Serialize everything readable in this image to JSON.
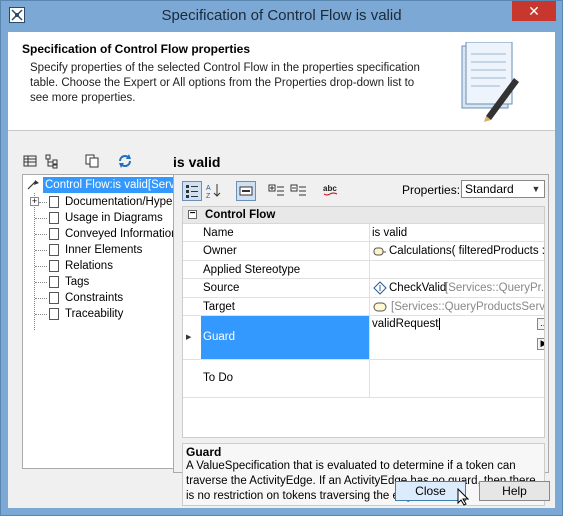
{
  "window": {
    "title": "Specification of Control Flow is valid",
    "close_glyph": "✕"
  },
  "header": {
    "title": "Specification of Control Flow properties",
    "description": "Specify properties of the selected Control Flow in the properties specification table. Choose the Expert or All options from the Properties drop-down list to see more properties."
  },
  "page_heading": "is valid",
  "left_toolbar": {
    "icons": [
      "list-view-icon",
      "tree-view-icon",
      "copy-icon",
      "refresh-icon"
    ]
  },
  "tree": {
    "root": "Control Flow:is valid[Servic",
    "items": [
      {
        "label": "Documentation/Hyperli",
        "expandable": true
      },
      {
        "label": "Usage in Diagrams",
        "expandable": false
      },
      {
        "label": "Conveyed Information",
        "expandable": false
      },
      {
        "label": "Inner Elements",
        "expandable": false
      },
      {
        "label": "Relations",
        "expandable": false
      },
      {
        "label": "Tags",
        "expandable": false
      },
      {
        "label": "Constraints",
        "expandable": false
      },
      {
        "label": "Traceability",
        "expandable": false
      }
    ]
  },
  "properties": {
    "label": "Properties:",
    "selected": "Standard",
    "toolbar_icons": [
      "categorized-icon",
      "sort-az-icon",
      "compact-icon",
      "expand-all-icon",
      "collapse-all-icon",
      "spelling-icon"
    ]
  },
  "grid": {
    "section": "Control Flow",
    "section_toggle": "−",
    "rows": [
      {
        "name": "Name",
        "value": "is valid",
        "value_gray": ""
      },
      {
        "name": "Owner",
        "value": "Calculations( filteredProducts :...",
        "value_gray": ""
      },
      {
        "name": "Applied Stereotype",
        "value": "",
        "value_gray": ""
      },
      {
        "name": "Source",
        "value": "CheckValid ",
        "value_gray": "[Services::QueryPr..."
      },
      {
        "name": "Target",
        "value": "",
        "value_gray": "[Services::QueryProductsServ..."
      },
      {
        "name": "Guard",
        "value": "validRequest",
        "value_gray": ""
      },
      {
        "name": "To Do",
        "value": "",
        "value_gray": ""
      }
    ],
    "ellipsis": "...",
    "expand_arrow": "▶"
  },
  "description_box": {
    "title": "Guard",
    "text": "A ValueSpecification that is evaluated to determine if a token can traverse the ActivityEdge. If an ActivityEdge has no guard, then there is no restriction on tokens traversing the edge."
  },
  "buttons": {
    "close": "Close",
    "help": "Help"
  },
  "colors": {
    "accent": "#3399ff",
    "titlebar": "#7ba8d4",
    "close": "#c7372d"
  }
}
